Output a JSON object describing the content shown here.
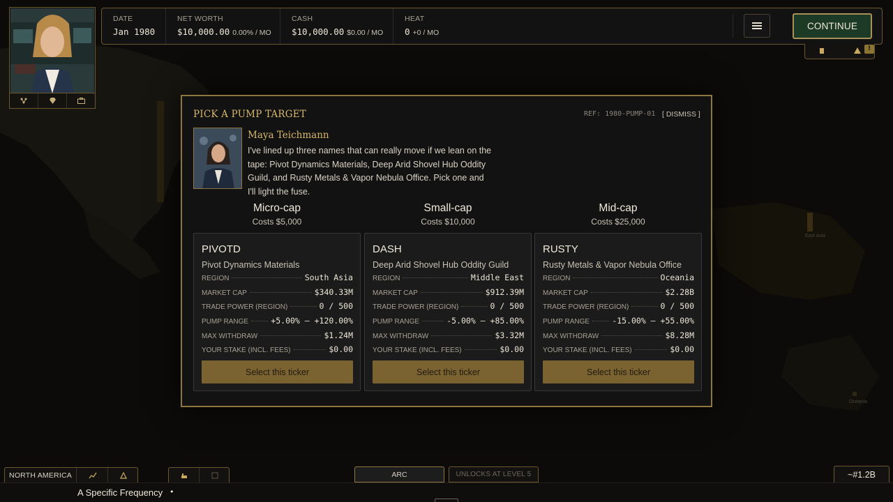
{
  "header": {
    "date": {
      "label": "DATE",
      "value": "Jan 1980"
    },
    "net_worth": {
      "label": "NET WORTH",
      "value": "$10,000.00",
      "delta": "0.00% / MO"
    },
    "cash": {
      "label": "CASH",
      "value": "$10,000.00",
      "delta": "$0.00 / MO"
    },
    "heat": {
      "label": "HEAT",
      "value": "0",
      "delta": "+0 / MO"
    },
    "menu_icon": "hamburger-icon",
    "continue_label": "CONTINUE",
    "tray_badge": "!"
  },
  "portrait_tabs": [
    "network-icon",
    "diamond-icon",
    "briefcase-icon"
  ],
  "modal": {
    "title": "PICK A PUMP TARGET",
    "ref": "REF: 1980-PUMP-01",
    "dismiss": "[ DISMISS ]",
    "npc_name": "Maya Teichmann",
    "message": "I've lined up three names that can really move if we lean on the tape: Pivot Dynamics Materials, Deep Arid Shovel Hub Oddity Guild, and Rusty Metals & Vapor Nebula Office. Pick one and I'll light the fuse.",
    "tiers": [
      {
        "name": "Micro-cap",
        "cost": "Costs $5,000"
      },
      {
        "name": "Small-cap",
        "cost": "Costs $10,000"
      },
      {
        "name": "Mid-cap",
        "cost": "Costs $25,000"
      }
    ],
    "row_labels": {
      "region": "REGION",
      "market_cap": "MARKET CAP",
      "trade_power": "TRADE POWER (REGION)",
      "pump_range": "PUMP RANGE",
      "max_withdraw": "MAX WITHDRAW",
      "stake": "YOUR STAKE (INCL. FEES)"
    },
    "cards": [
      {
        "ticker": "PIVOTD",
        "company": "Pivot Dynamics Materials",
        "region": "South Asia",
        "market_cap": "$340.33M",
        "trade_power": "0 / 500",
        "pump_range": "+5.00% – +120.00%",
        "max_withdraw": "$1.24M",
        "stake": "$0.00",
        "button": "Select this ticker"
      },
      {
        "ticker": "DASH",
        "company": "Deep Arid Shovel Hub Oddity Guild",
        "region": "Middle East",
        "market_cap": "$912.39M",
        "trade_power": "0 / 500",
        "pump_range": "-5.00% – +85.00%",
        "max_withdraw": "$3.32M",
        "stake": "$0.00",
        "button": "Select this ticker"
      },
      {
        "ticker": "RUSTY",
        "company": "Rusty Metals & Vapor Nebula Office",
        "region": "Oceania",
        "market_cap": "$2.28B",
        "trade_power": "0 / 500",
        "pump_range": "-15.00% – +55.00%",
        "max_withdraw": "$8.28M",
        "stake": "$0.00",
        "button": "Select this ticker"
      }
    ]
  },
  "map": {
    "labels": [
      "East Asia",
      "Oceania"
    ]
  },
  "bottom": {
    "region": "NORTH AMERICA",
    "region_icons": [
      "chart-icon",
      "building-icon"
    ],
    "tool_icons": [
      "hand-icon",
      "calendar-icon"
    ],
    "arc": "ARC",
    "unlocks": "UNLOCKS AT LEVEL 5",
    "population": "~#1.2B",
    "track": "A Specific Frequency",
    "track_dot": "•"
  }
}
